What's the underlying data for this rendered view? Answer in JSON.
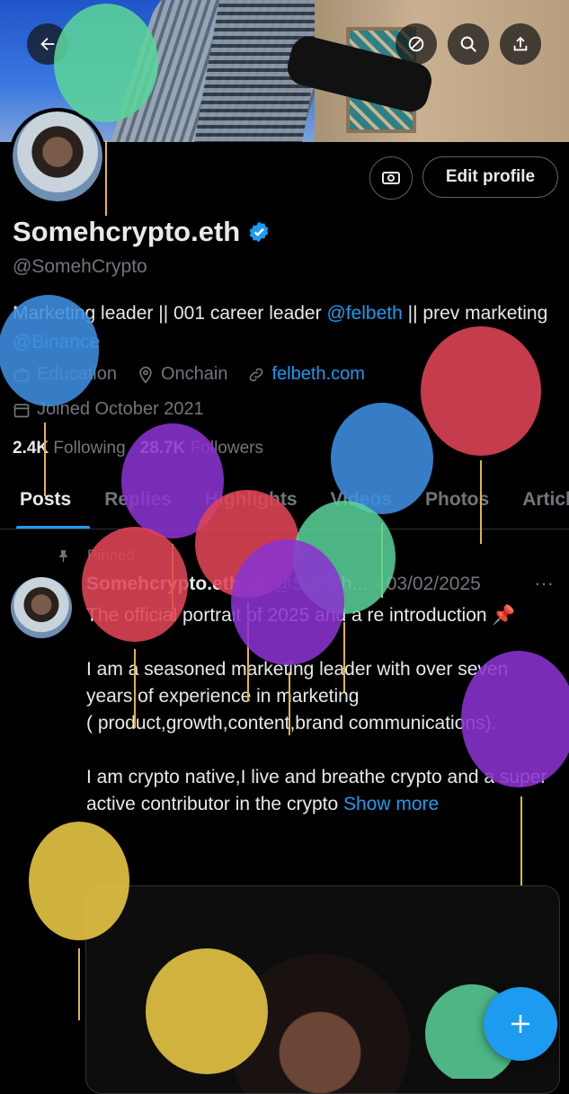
{
  "profile": {
    "display_name": "Somehcrypto.eth",
    "handle": "@SomehCrypto",
    "bio_text_1": "Marketing leader || 001 career leader ",
    "bio_link_1": "@felbeth",
    "bio_text_2": "  || prev marketing ",
    "bio_link_2": "@Binance",
    "category": "Education",
    "location": "Onchain",
    "website": "felbeth.com",
    "joined": "Joined October 2021",
    "following_count": "2.4K",
    "following_label": "Following",
    "followers_count": "28.7K",
    "followers_label": "Followers",
    "edit_profile_label": "Edit profile"
  },
  "tabs": [
    "Posts",
    "Replies",
    "Highlights",
    "Videos",
    "Photos",
    "Articles"
  ],
  "post": {
    "pinned_label": "Pinned",
    "author_name": "Somehcrypto.eth",
    "author_handle": "@Someh...",
    "date": "· 03/02/2025",
    "more_icon": "···",
    "text": "The official portrait of 2025 and a re introduction 📌\n\nI am a seasoned marketing leader with over seven years of experience in marketing\n( product,growth,content,brand communications).\n\nI am crypto native,I live and breathe crypto and a super active contributor in the crypto ",
    "show_more": "Show more"
  },
  "colors": {
    "accent": "#1d9bf0",
    "background": "#000000",
    "muted": "#71767b"
  }
}
